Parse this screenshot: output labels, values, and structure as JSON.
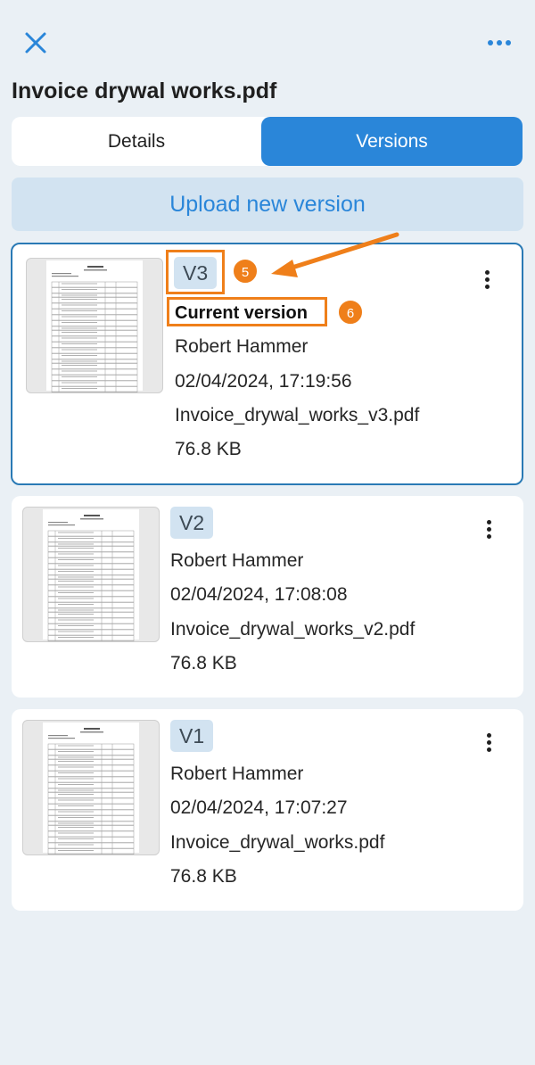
{
  "header": {
    "close_icon": "close-x-icon",
    "more_icon": "more-horizontal-icon",
    "title": "Invoice drywal works.pdf"
  },
  "tabs": [
    {
      "label": "Details",
      "selected": false
    },
    {
      "label": "Versions",
      "selected": true
    }
  ],
  "upload_label": "Upload new version",
  "versions": [
    {
      "badge": "V3",
      "current_label": "Current version",
      "author": "Robert Hammer",
      "timestamp": "02/04/2024, 17:19:56",
      "filename": "Invoice_drywal_works_v3.pdf",
      "size": "76.8 KB"
    },
    {
      "badge": "V2",
      "author": "Robert Hammer",
      "timestamp": "02/04/2024, 17:08:08",
      "filename": "Invoice_drywal_works_v2.pdf",
      "size": "76.8 KB"
    },
    {
      "badge": "V1",
      "author": "Robert Hammer",
      "timestamp": "02/04/2024, 17:07:27",
      "filename": "Invoice_drywal_works.pdf",
      "size": "76.8 KB"
    }
  ],
  "annotations": {
    "step5": "5",
    "step6": "6"
  },
  "colors": {
    "accent": "#2a86d9",
    "annotation": "#ef7f1a",
    "badge_bg": "#d2e3f1",
    "background": "#eaf0f5"
  }
}
